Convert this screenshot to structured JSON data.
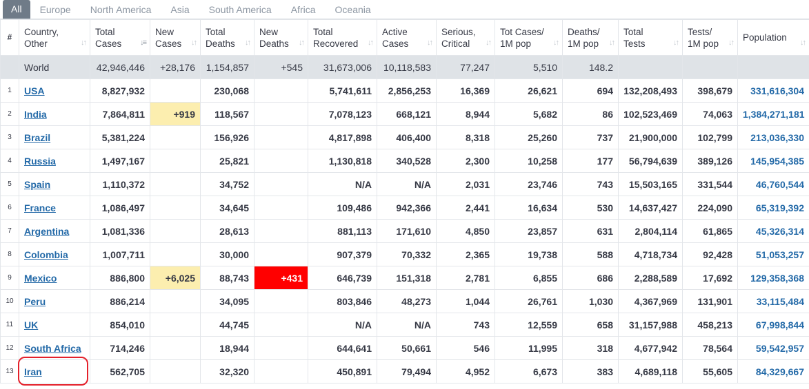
{
  "tabs": [
    "All",
    "Europe",
    "North America",
    "Asia",
    "South America",
    "Africa",
    "Oceania"
  ],
  "active_tab": "All",
  "headers": {
    "idx": "#",
    "country": [
      "Country,",
      "Other"
    ],
    "total_cases": [
      "Total",
      "Cases"
    ],
    "new_cases": [
      "New",
      "Cases"
    ],
    "total_deaths": [
      "Total",
      "Deaths"
    ],
    "new_deaths": [
      "New",
      "Deaths"
    ],
    "total_recovered": [
      "Total",
      "Recovered"
    ],
    "active_cases": [
      "Active",
      "Cases"
    ],
    "serious": [
      "Serious,",
      "Critical"
    ],
    "tot_cases_1m": [
      "Tot Cases/",
      "1M pop"
    ],
    "deaths_1m": [
      "Deaths/",
      "1M pop"
    ],
    "total_tests": [
      "Total",
      "Tests"
    ],
    "tests_1m": [
      "Tests/",
      "1M pop"
    ],
    "population": [
      "Population"
    ]
  },
  "world": {
    "country": "World",
    "total_cases": "42,946,446",
    "new_cases": "+28,176",
    "total_deaths": "1,154,857",
    "new_deaths": "+545",
    "total_recovered": "31,673,006",
    "active_cases": "10,118,583",
    "serious": "77,247",
    "tot_cases_1m": "5,510",
    "deaths_1m": "148.2",
    "total_tests": "",
    "tests_1m": "",
    "population": ""
  },
  "rows": [
    {
      "idx": "1",
      "country": "USA",
      "total_cases": "8,827,932",
      "new_cases": "",
      "total_deaths": "230,068",
      "new_deaths": "",
      "total_recovered": "5,741,611",
      "active_cases": "2,856,253",
      "serious": "16,369",
      "tot_cases_1m": "26,621",
      "deaths_1m": "694",
      "total_tests": "132,208,493",
      "tests_1m": "398,679",
      "population": "331,616,304"
    },
    {
      "idx": "2",
      "country": "India",
      "total_cases": "7,864,811",
      "new_cases": "+919",
      "total_deaths": "118,567",
      "new_deaths": "",
      "total_recovered": "7,078,123",
      "active_cases": "668,121",
      "serious": "8,944",
      "tot_cases_1m": "5,682",
      "deaths_1m": "86",
      "total_tests": "102,523,469",
      "tests_1m": "74,063",
      "population": "1,384,271,181"
    },
    {
      "idx": "3",
      "country": "Brazil",
      "total_cases": "5,381,224",
      "new_cases": "",
      "total_deaths": "156,926",
      "new_deaths": "",
      "total_recovered": "4,817,898",
      "active_cases": "406,400",
      "serious": "8,318",
      "tot_cases_1m": "25,260",
      "deaths_1m": "737",
      "total_tests": "21,900,000",
      "tests_1m": "102,799",
      "population": "213,036,330"
    },
    {
      "idx": "4",
      "country": "Russia",
      "total_cases": "1,497,167",
      "new_cases": "",
      "total_deaths": "25,821",
      "new_deaths": "",
      "total_recovered": "1,130,818",
      "active_cases": "340,528",
      "serious": "2,300",
      "tot_cases_1m": "10,258",
      "deaths_1m": "177",
      "total_tests": "56,794,639",
      "tests_1m": "389,126",
      "population": "145,954,385"
    },
    {
      "idx": "5",
      "country": "Spain",
      "total_cases": "1,110,372",
      "new_cases": "",
      "total_deaths": "34,752",
      "new_deaths": "",
      "total_recovered": "N/A",
      "active_cases": "N/A",
      "serious": "2,031",
      "tot_cases_1m": "23,746",
      "deaths_1m": "743",
      "total_tests": "15,503,165",
      "tests_1m": "331,544",
      "population": "46,760,544"
    },
    {
      "idx": "6",
      "country": "France",
      "total_cases": "1,086,497",
      "new_cases": "",
      "total_deaths": "34,645",
      "new_deaths": "",
      "total_recovered": "109,486",
      "active_cases": "942,366",
      "serious": "2,441",
      "tot_cases_1m": "16,634",
      "deaths_1m": "530",
      "total_tests": "14,637,427",
      "tests_1m": "224,090",
      "population": "65,319,392"
    },
    {
      "idx": "7",
      "country": "Argentina",
      "total_cases": "1,081,336",
      "new_cases": "",
      "total_deaths": "28,613",
      "new_deaths": "",
      "total_recovered": "881,113",
      "active_cases": "171,610",
      "serious": "4,850",
      "tot_cases_1m": "23,857",
      "deaths_1m": "631",
      "total_tests": "2,804,114",
      "tests_1m": "61,865",
      "population": "45,326,314"
    },
    {
      "idx": "8",
      "country": "Colombia",
      "total_cases": "1,007,711",
      "new_cases": "",
      "total_deaths": "30,000",
      "new_deaths": "",
      "total_recovered": "907,379",
      "active_cases": "70,332",
      "serious": "2,365",
      "tot_cases_1m": "19,738",
      "deaths_1m": "588",
      "total_tests": "4,718,734",
      "tests_1m": "92,428",
      "population": "51,053,257"
    },
    {
      "idx": "9",
      "country": "Mexico",
      "total_cases": "886,800",
      "new_cases": "+6,025",
      "total_deaths": "88,743",
      "new_deaths": "+431",
      "total_recovered": "646,739",
      "active_cases": "151,318",
      "serious": "2,781",
      "tot_cases_1m": "6,855",
      "deaths_1m": "686",
      "total_tests": "2,288,589",
      "tests_1m": "17,692",
      "population": "129,358,368"
    },
    {
      "idx": "10",
      "country": "Peru",
      "total_cases": "886,214",
      "new_cases": "",
      "total_deaths": "34,095",
      "new_deaths": "",
      "total_recovered": "803,846",
      "active_cases": "48,273",
      "serious": "1,044",
      "tot_cases_1m": "26,761",
      "deaths_1m": "1,030",
      "total_tests": "4,367,969",
      "tests_1m": "131,901",
      "population": "33,115,484"
    },
    {
      "idx": "11",
      "country": "UK",
      "total_cases": "854,010",
      "new_cases": "",
      "total_deaths": "44,745",
      "new_deaths": "",
      "total_recovered": "N/A",
      "active_cases": "N/A",
      "serious": "743",
      "tot_cases_1m": "12,559",
      "deaths_1m": "658",
      "total_tests": "31,157,988",
      "tests_1m": "458,213",
      "population": "67,998,844"
    },
    {
      "idx": "12",
      "country": "South Africa",
      "total_cases": "714,246",
      "new_cases": "",
      "total_deaths": "18,944",
      "new_deaths": "",
      "total_recovered": "644,641",
      "active_cases": "50,661",
      "serious": "546",
      "tot_cases_1m": "11,995",
      "deaths_1m": "318",
      "total_tests": "4,677,942",
      "tests_1m": "78,564",
      "population": "59,542,957"
    },
    {
      "idx": "13",
      "country": "Iran",
      "total_cases": "562,705",
      "new_cases": "",
      "total_deaths": "32,320",
      "new_deaths": "",
      "total_recovered": "450,891",
      "active_cases": "79,494",
      "serious": "4,952",
      "tot_cases_1m": "6,673",
      "deaths_1m": "383",
      "total_tests": "4,689,118",
      "tests_1m": "55,605",
      "population": "84,329,667"
    }
  ],
  "colors": {
    "active_tab_bg": "#6f7b88",
    "link": "#246aa8",
    "world_row_bg": "#dfe3e7",
    "new_cases_highlight": "#fceeaf",
    "new_deaths_highlight": "#ff0000",
    "annotation_ring": "#e4202a"
  },
  "icons": {
    "sort": "sort-arrows-icon",
    "sort_active": "sort-desc-icon"
  }
}
